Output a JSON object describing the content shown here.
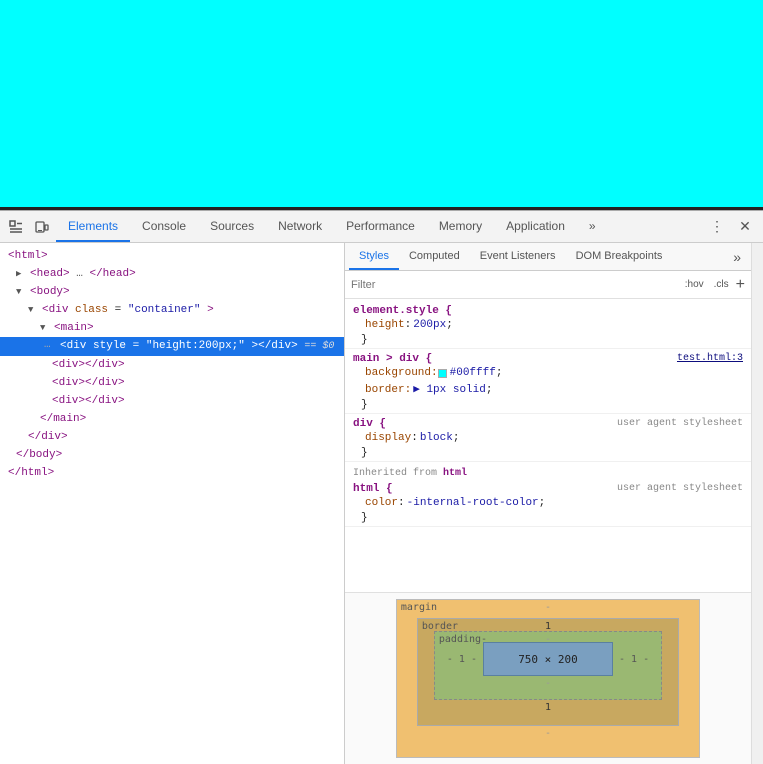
{
  "viewport": {
    "background": "#00ffff"
  },
  "devtools": {
    "toolbar": {
      "inspect_label": "⬚",
      "device_label": "▭",
      "more_label": "»",
      "settings_label": "⋮",
      "close_label": "✕"
    },
    "tabs": [
      {
        "id": "elements",
        "label": "Elements",
        "active": true
      },
      {
        "id": "console",
        "label": "Console",
        "active": false
      },
      {
        "id": "sources",
        "label": "Sources",
        "active": false
      },
      {
        "id": "network",
        "label": "Network",
        "active": false
      },
      {
        "id": "performance",
        "label": "Performance",
        "active": false
      },
      {
        "id": "memory",
        "label": "Memory",
        "active": false
      },
      {
        "id": "application",
        "label": "Application",
        "active": false
      }
    ],
    "dom": {
      "lines": [
        {
          "id": "html-open",
          "indent": 0,
          "content": "<html>"
        },
        {
          "id": "head",
          "indent": 1,
          "content": "▶ <head>…</head>"
        },
        {
          "id": "body-open",
          "indent": 1,
          "content": "▼ <body>"
        },
        {
          "id": "div-container",
          "indent": 2,
          "content": "▼ <div class=\"container\">"
        },
        {
          "id": "main-open",
          "indent": 3,
          "content": "▼ <main>"
        },
        {
          "id": "div-style",
          "indent": 4,
          "content": "<div style=\"height:200px;\"></div>  == $0",
          "selected": true
        },
        {
          "id": "div-1",
          "indent": 4,
          "content": "<div></div>"
        },
        {
          "id": "div-2",
          "indent": 4,
          "content": "<div></div>"
        },
        {
          "id": "div-3",
          "indent": 4,
          "content": "<div></div>"
        },
        {
          "id": "main-close",
          "indent": 3,
          "content": "</main>"
        },
        {
          "id": "div-close",
          "indent": 2,
          "content": "</div>"
        },
        {
          "id": "body-close",
          "indent": 1,
          "content": "</body>"
        },
        {
          "id": "html-close",
          "indent": 0,
          "content": "</html>"
        }
      ]
    },
    "styles": {
      "subtabs": [
        {
          "id": "styles",
          "label": "Styles",
          "active": true
        },
        {
          "id": "computed",
          "label": "Computed",
          "active": false
        },
        {
          "id": "event-listeners",
          "label": "Event Listeners",
          "active": false
        },
        {
          "id": "dom-breakpoints",
          "label": "DOM Breakpoints",
          "active": false
        }
      ],
      "filter": {
        "placeholder": "Filter",
        "hov_label": ":hov",
        "cls_label": ".cls",
        "plus_label": "+"
      },
      "rules": [
        {
          "selector": "element.style {",
          "source": "",
          "props": [
            {
              "name": "height",
              "value": "200px",
              "color": null
            }
          ]
        },
        {
          "selector": "main > div {",
          "source": "test.html:3",
          "props": [
            {
              "name": "background:",
              "value": "#00ffff",
              "color": "#00ffff"
            },
            {
              "name": "border:",
              "value": "1px solid",
              "color": null
            }
          ]
        },
        {
          "selector": "div {",
          "source": "user agent stylesheet",
          "props": [
            {
              "name": "display",
              "value": "block"
            }
          ]
        }
      ],
      "inherited_from": "html",
      "inherited_rule": {
        "selector": "html {",
        "source": "user agent stylesheet",
        "props": [
          {
            "name": "color",
            "value": "-internal-root-color"
          }
        ]
      },
      "box_model": {
        "margin_label": "margin",
        "margin_val": "-",
        "border_label": "border",
        "border_val": "1",
        "padding_label": "padding-",
        "padding_val": "-",
        "side_left": "- 1 -",
        "side_right": "- 1 -",
        "size": "750 × 200",
        "bottom_val": "1",
        "bottom_outer": "-"
      }
    }
  }
}
